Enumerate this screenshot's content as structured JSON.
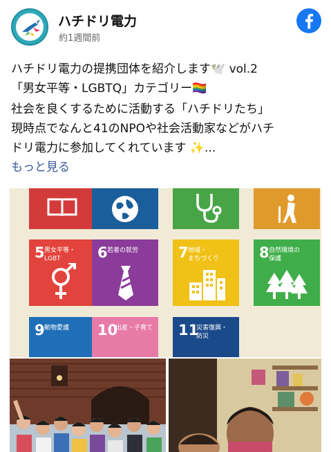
{
  "header": {
    "page_name": "ハチドリ電力",
    "time": "約1週間前",
    "platform_icon": "facebook-icon",
    "avatar_icon": "hummingbird-logo-icon"
  },
  "post": {
    "line1": "ハチドリ電力の提携団体を紹介します🕊️ vol.2",
    "line2": "「男女平等・LGBTQ」カテゴリー🏳️‍🌈",
    "line3": "社会を良くするために活動する「ハチドリたち」",
    "line4": "現時点でなんと41のNPOや社会活動家などがハチ",
    "line5": "ドリ電力に参加してくれています ✨...",
    "see_more": "もっと見る"
  },
  "sdg_tiles": [
    {
      "num": "",
      "label": "",
      "color": "#d33b3b",
      "icon": "book-icon"
    },
    {
      "num": "",
      "label": "",
      "color": "#1a5e9c",
      "icon": "globe-icon"
    },
    {
      "num": "",
      "label": "",
      "color": "#48a547",
      "icon": "stethoscope-icon"
    },
    {
      "num": "",
      "label": "",
      "color": "#e09a2c",
      "icon": "elderly-icon"
    },
    {
      "num": "5",
      "label": "男女平等・\nLGBT",
      "color": "#e2433c",
      "icon": "gender-icon"
    },
    {
      "num": "6",
      "label": "若者の就労",
      "color": "#8b3c9a",
      "icon": "necktie-icon"
    },
    {
      "num": "7",
      "label": "地域・\nまちづくり",
      "color": "#f0c116",
      "icon": "buildings-icon"
    },
    {
      "num": "8",
      "label": "自然環境の\n保護",
      "color": "#3fae4a",
      "icon": "trees-icon"
    },
    {
      "num": "9",
      "label": "動物愛護",
      "color": "#1f6fb8",
      "icon": "animal-icon"
    },
    {
      "num": "10",
      "label": "出産・子育て",
      "color": "#e87aa8",
      "icon": "family-icon"
    },
    {
      "num": "11",
      "label": "災害復興・\n防災",
      "color": "#1a4a8a",
      "icon": "disaster-icon"
    }
  ],
  "colors": {
    "facebook_blue": "#1877f2",
    "link_blue": "#385898",
    "panel_background": "#f1ead6"
  }
}
